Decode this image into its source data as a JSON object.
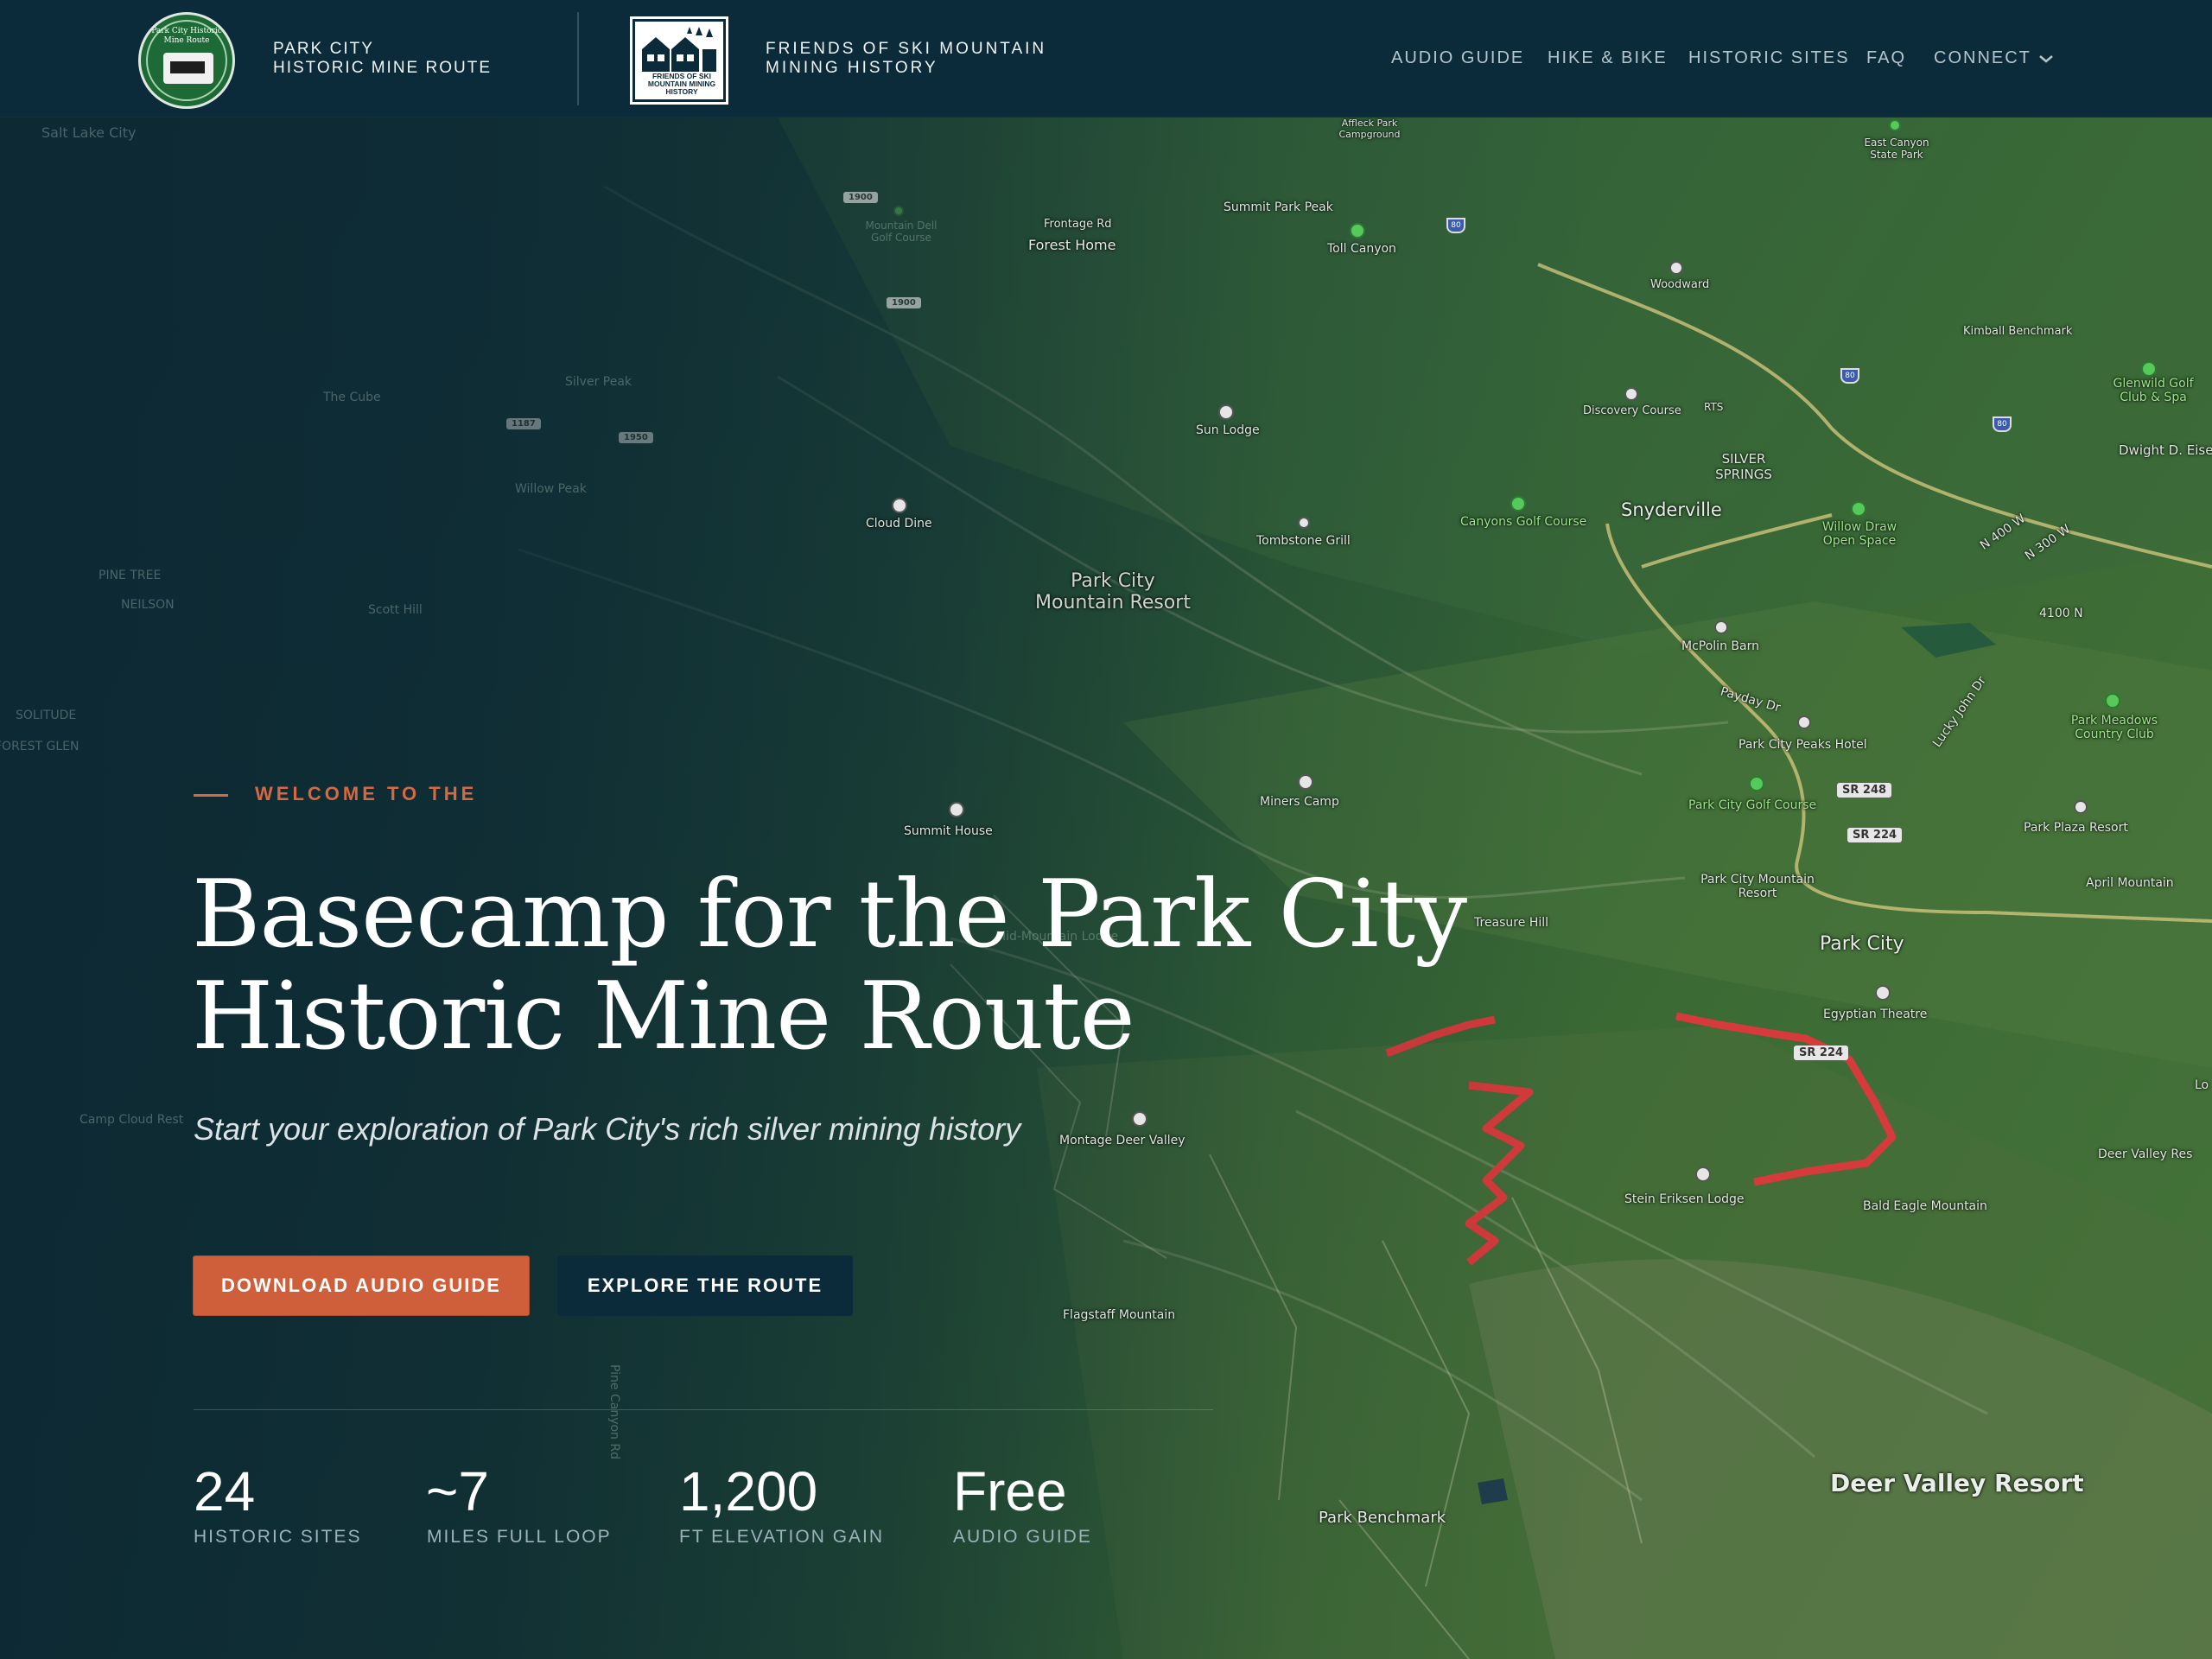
{
  "header": {
    "logo1_text": "Park City Historic Mine Route",
    "brand1_line1": "PARK CITY",
    "brand1_line2": "HISTORIC MINE ROUTE",
    "logo2_text": "FRIENDS OF SKI MOUNTAIN MINING HISTORY",
    "brand2_line1": "FRIENDS OF SKI MOUNTAIN",
    "brand2_line2": "MINING HISTORY",
    "nav": [
      {
        "label": "AUDIO GUIDE"
      },
      {
        "label": "HIKE & BIKE"
      },
      {
        "label": "HISTORIC SITES"
      },
      {
        "label": "FAQ"
      },
      {
        "label": "CONNECT"
      }
    ]
  },
  "hero": {
    "eyebrow": "WELCOME TO THE",
    "headline_line1": "Basecamp for the Park City",
    "headline_line2": "Historic Mine Route",
    "subhead": "Start your exploration of Park City's rich silver mining history",
    "primary_button": "DOWNLOAD AUDIO GUIDE",
    "secondary_button": "EXPLORE THE ROUTE",
    "stats": [
      {
        "value": "24",
        "label": "HISTORIC SITES"
      },
      {
        "value": "~7",
        "label": "MILES FULL LOOP"
      },
      {
        "value": "1,200",
        "label": "FT ELEVATION GAIN"
      },
      {
        "value": "Free",
        "label": "AUDIO GUIDE"
      }
    ]
  },
  "map": {
    "labels": {
      "salt_lake_city": "Salt Lake City",
      "affleck": "Affleck Park Campground",
      "east_canyon": "East Canyon State Park",
      "mountain_dell": "Mountain Dell Golf Course",
      "frontage_rd": "Frontage Rd",
      "forest_home": "Forest Home",
      "summit_park_peak": "Summit Park Peak",
      "toll_canyon": "Toll Canyon",
      "woodward": "Woodward",
      "kimball": "Kimball Benchmark",
      "glenwild": "Glenwild Golf Club & Spa",
      "dwight": "Dwight D. Eise",
      "sun_lodge": "Sun Lodge",
      "discovery": "Discovery Course",
      "rts": "RTS",
      "silver_springs": "SILVER SPRINGS",
      "the_cube": "The Cube",
      "silver_peak": "Silver Peak",
      "willow_peak": "Willow Peak",
      "cloud_dine": "Cloud Dine",
      "tombstone": "Tombstone Grill",
      "canyons_golf": "Canyons Golf Course",
      "snyderville": "Snyderville",
      "willow_draw": "Willow Draw Open Space",
      "n400w": "N 400 W",
      "n300w": "N 300 W",
      "n4100": "4100 N",
      "pine_tree": "PINE TREE",
      "neilson": "NEILSON",
      "scott_hill": "Scott Hill",
      "pcmr": "Park City Mountain Resort",
      "mcpolin": "McPolin Barn",
      "payday": "Payday Dr",
      "lucky_john": "Lucky John Dr",
      "pc_peaks": "Park City Peaks Hotel",
      "park_meadows": "Park Meadows Country Club",
      "solitude": "SOLITUDE",
      "forest_glen": "FOREST GLEN",
      "miners_camp": "Miners Camp",
      "summit_house": "Summit House",
      "pc_golf": "Park City Golf Course",
      "sr248": "SR 248",
      "sr224a": "SR 224",
      "park_plaza": "Park Plaza Resort",
      "april_mountain": "April Mountain",
      "pcmr2": "Park City Mountain Resort",
      "treasure_hill": "Treasure Hill",
      "mid_mountain_lodge": "Mid-Mountain Lodge",
      "park_city": "Park City",
      "egyptian": "Egyptian Theatre",
      "sr224b": "SR 224",
      "camp_cloud": "Camp Cloud Rest",
      "montage": "Montage Deer Valley",
      "stein": "Stein Eriksen Lodge",
      "bald_eagle": "Bald Eagle Mountain",
      "deer_valley_res": "Deer Valley Res",
      "flagstaff": "Flagstaff Mountain",
      "pine_canyon": "Pine Canyon Rd",
      "park_benchmark": "Park Benchmark",
      "deer_valley_resort": "Deer Valley Resort",
      "lo": "Lo",
      "shield_80": "80",
      "road_1900": "1900",
      "road_1187": "1187",
      "road_1950": "1950"
    }
  }
}
